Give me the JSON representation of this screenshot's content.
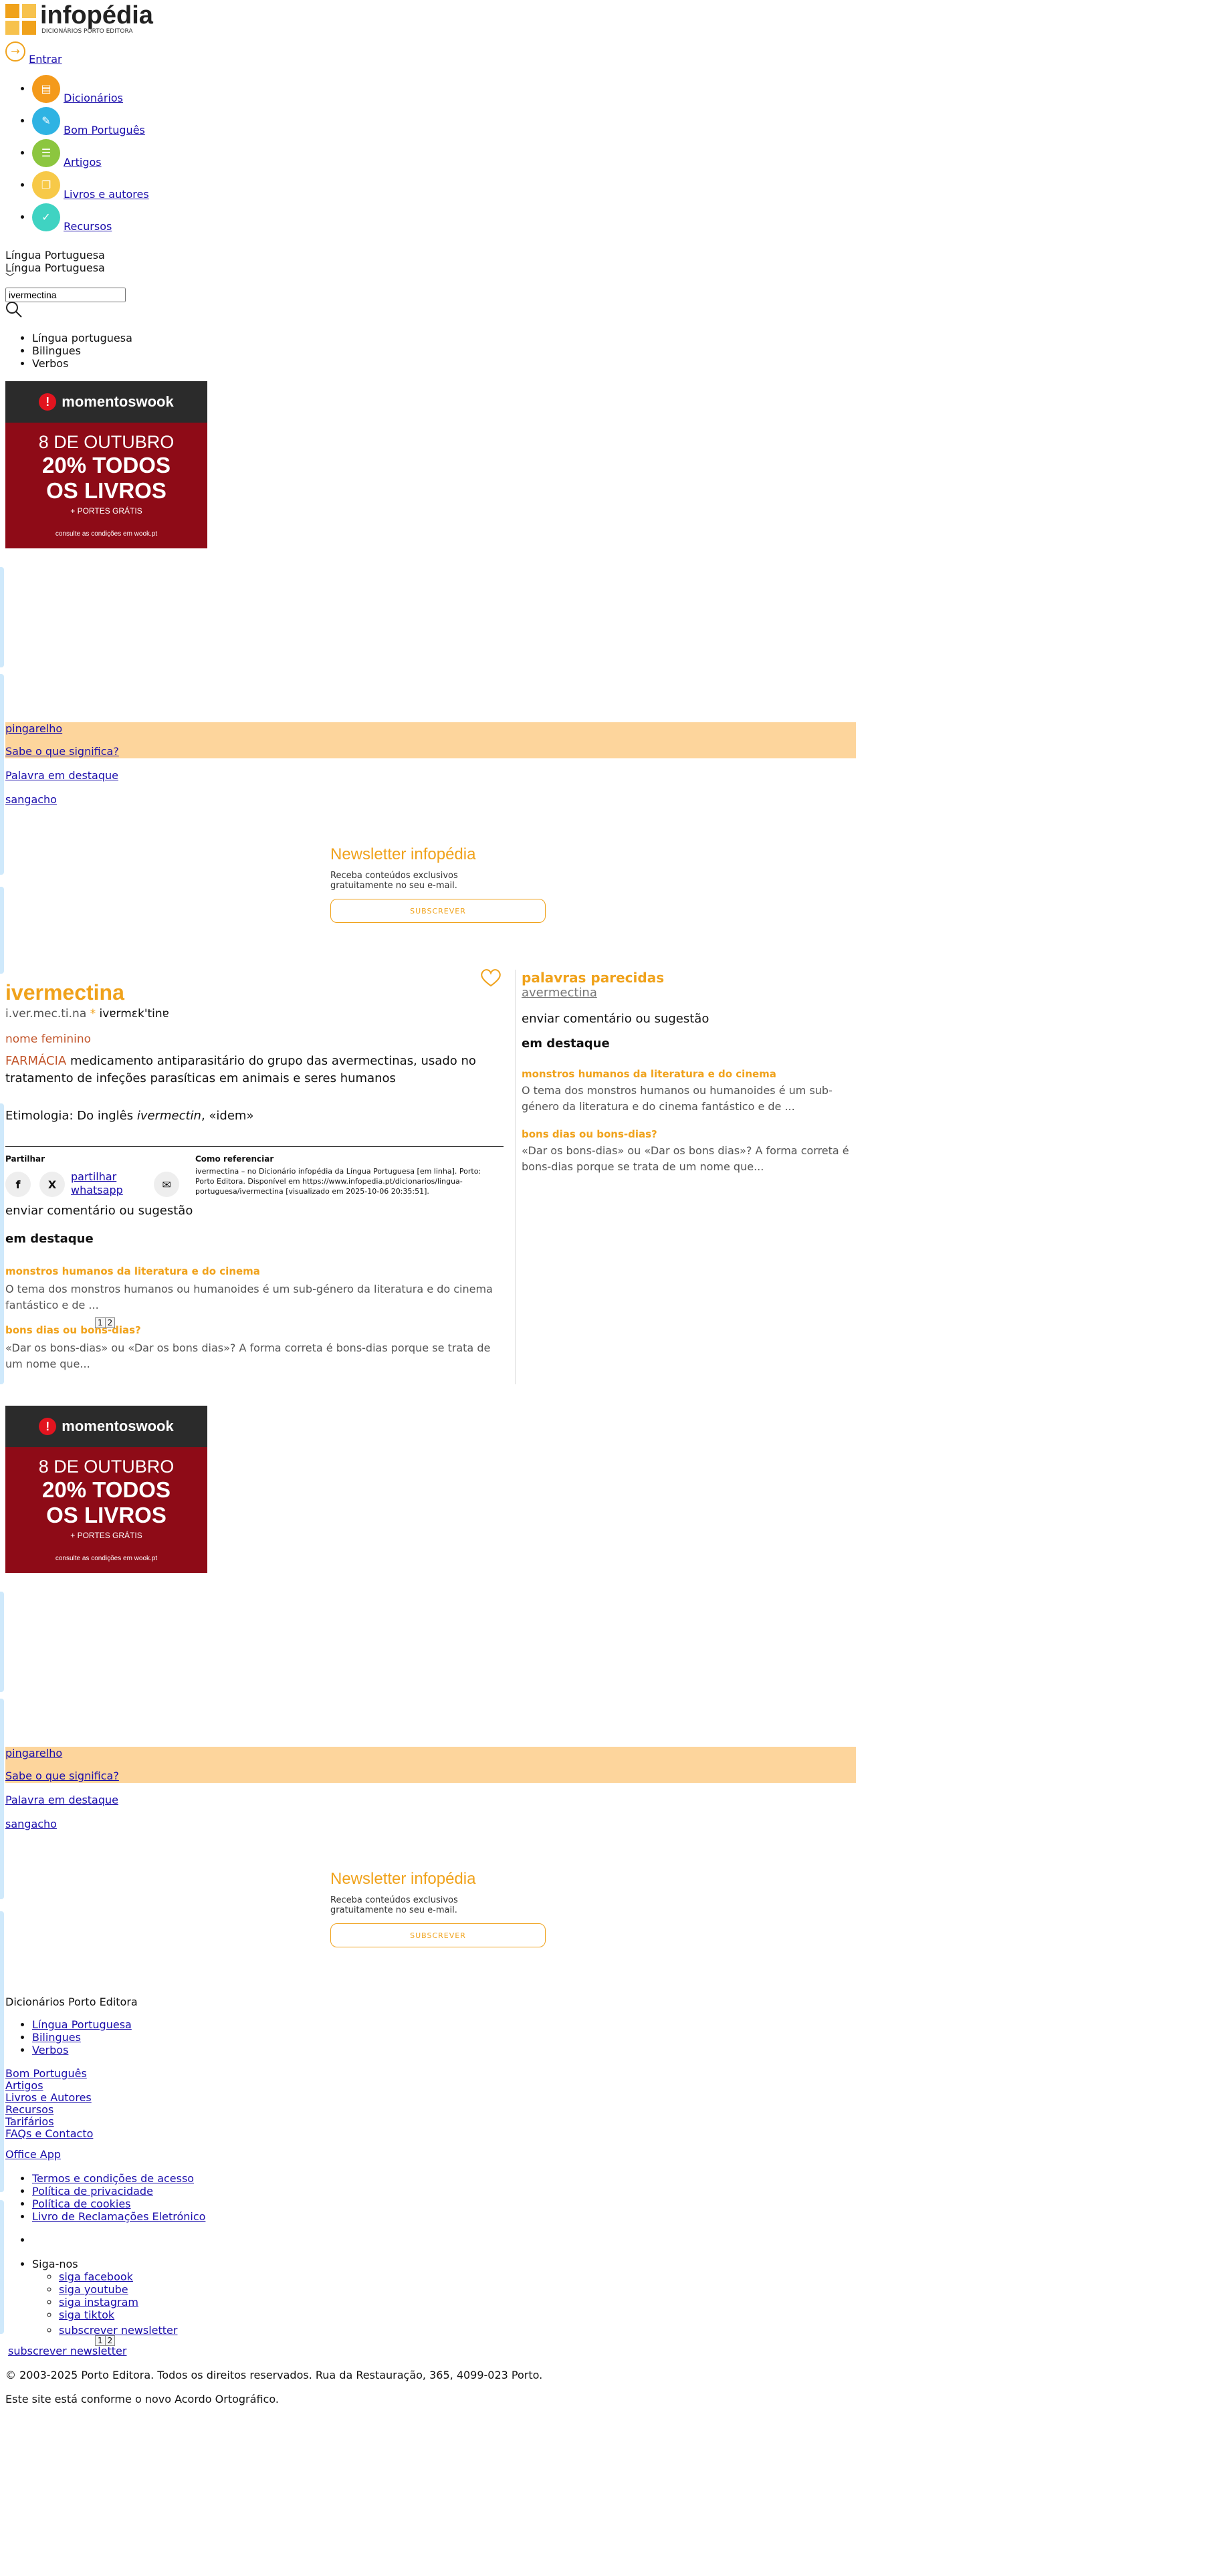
{
  "header": {
    "logo_text": "infopédia",
    "logo_sub": "DICIONÁRIOS PORTO EDITORA",
    "login_label": "Entrar",
    "colors": {
      "brand": "#f0a21b"
    }
  },
  "nav": {
    "items": [
      {
        "label": "Dicionários",
        "icon": "dictionary-icon",
        "color": "#f49a1b"
      },
      {
        "label": "Bom Português",
        "icon": "chat-icon",
        "color": "#2fb3e3"
      },
      {
        "label": "Artigos",
        "icon": "article-icon",
        "color": "#8cc63f"
      },
      {
        "label": "Livros e autores",
        "icon": "book-icon",
        "color": "#f7c948"
      },
      {
        "label": "Recursos",
        "icon": "resources-icon",
        "color": "#3fd3c2"
      }
    ]
  },
  "search": {
    "dictionary_selected": "Língua Portuguesa",
    "dictionary_selected_repeat": "Língua Portuguesa",
    "query": "ivermectina",
    "tabs": [
      "Língua portuguesa",
      "Bilingues",
      "Verbos"
    ]
  },
  "promo": {
    "brand": "momentoswook",
    "line1": "8 DE OUTUBRO",
    "line2": "20% TODOS",
    "line3": "OS LIVROS",
    "line4": "+ PORTES GRÁTIS",
    "line5": "consulte as condições em wook.pt"
  },
  "word_of_day": {
    "word": "pingarelho",
    "question": "Sabe o que significa?",
    "featured_label": "Palavra em destaque",
    "featured_word": "sangacho"
  },
  "newsletter": {
    "title": "Newsletter infopédia",
    "text": "Receba conteúdos exclusivos gratuitamente no seu e-mail.",
    "button": "SUBSCREVER"
  },
  "entry": {
    "headword": "ivermectina",
    "syllables": "i.ver.mec.ti.na",
    "pron_marker": "*",
    "pronunciation": "ivɐrmɛk'tinɐ",
    "pos": "nome feminino",
    "domain": "FARMÁCIA",
    "definition": "medicamento antiparasitário do grupo das avermectinas, usado no tratamento de infeções parasíticas em animais e seres humanos",
    "etymology_label": "Etimologia: Do inglês",
    "etymology_word": "ivermectin",
    "etymology_rest": ", «idem»",
    "share_label": "Partilhar",
    "cite_label": "Como referenciar",
    "cite_text": "ivermectina – no Dicionário infopédia da Língua Portuguesa [em linha]. Porto: Porto Editora. Disponível em https://www.infopedia.pt/dicionarios/lingua-portuguesa/ivermectina [visualizado em 2025-10-06 20:35:51].",
    "whatsapp_alt": "partilhar whatsapp",
    "feedback": "enviar comentário ou sugestão"
  },
  "featured": {
    "title": "em destaque",
    "items": [
      {
        "title": "monstros humanos da literatura e do cinema",
        "text": "O tema dos monstros humanos ou humanoides é um sub-género da literatura e do cinema fantástico e de ..."
      },
      {
        "title": "bons dias ou bons-dias?",
        "text": "«Dar os bons-dias» ou «Dar os bons dias»? A forma correta é bons-dias porque se trata de um nome que..."
      }
    ],
    "pager": [
      "1",
      "2"
    ]
  },
  "sidebar": {
    "similar_title": "palavras parecidas",
    "similar_word": "avermectina",
    "feedback": "enviar comentário ou sugestão",
    "featured_title": "em destaque",
    "items": [
      {
        "title": "monstros humanos da literatura e do cinema",
        "text": "O tema dos monstros humanos ou humanoides é um sub-género da literatura e do cinema fantástico e de ..."
      },
      {
        "title": "bons dias ou bons-dias?",
        "text": "«Dar os bons-dias» ou «Dar os bons dias»? A forma correta é bons-dias porque se trata de um nome que..."
      }
    ]
  },
  "footer": {
    "brand": "Dicionários Porto Editora",
    "dict_links": [
      "Língua Portuguesa",
      "Bilingues",
      "Verbos"
    ],
    "links": [
      "Bom Português",
      "Artigos",
      "Livros e Autores",
      "Recursos",
      "Tarifários",
      "FAQs e Contacto"
    ],
    "office_app": "Office App",
    "legal": [
      "Termos e condições de acesso",
      "Política de privacidade",
      "Política de cookies",
      "Livro de Reclamações Eletrónico"
    ],
    "follow_label": "Siga-nos",
    "social": [
      "siga facebook",
      "siga youtube",
      "siga instagram",
      "siga tiktok"
    ],
    "subscribe": "subscrever newsletter",
    "subscribe2": "subscrever newsletter",
    "pager": [
      "1",
      "2"
    ],
    "copyright": "© 2003-2025 Porto Editora. Todos os direitos reservados. Rua da Restauração, 365, 4099-023 Porto.",
    "ao_note": "Este site está conforme o novo Acordo Ortográfico."
  }
}
